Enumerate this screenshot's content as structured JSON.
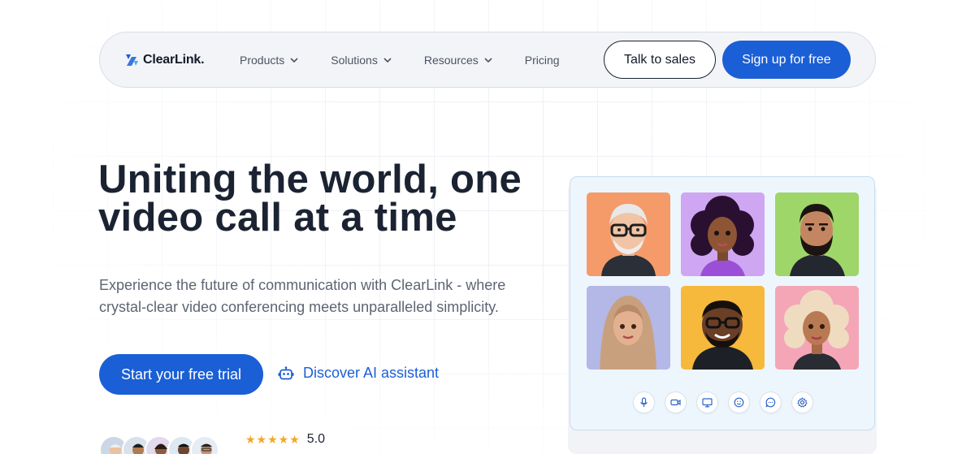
{
  "brand": {
    "name": "ClearLink.",
    "accent": "#1b5fd6"
  },
  "nav": {
    "items": [
      {
        "label": "Products",
        "has_dropdown": true
      },
      {
        "label": "Solutions",
        "has_dropdown": true
      },
      {
        "label": "Resources",
        "has_dropdown": true
      },
      {
        "label": "Pricing",
        "has_dropdown": false
      }
    ],
    "talk_to_sales": "Talk to sales",
    "sign_up": "Sign up for free"
  },
  "hero": {
    "title_line1": "Uniting the world, one",
    "title_line2": "video call at a time",
    "subtitle_line1": "Experience the future of communication with ClearLink - where",
    "subtitle_line2": "crystal-clear video conferencing meets unparalleled simplicity.",
    "cta_primary": "Start your free trial",
    "cta_secondary": "Discover AI assistant"
  },
  "social_proof": {
    "stars": "★★★★★",
    "rating": "5.0"
  },
  "video_panel": {
    "participants": [
      {
        "name": "participant-elder-man",
        "bg": "#f59b6a"
      },
      {
        "name": "participant-curly-woman",
        "bg": "#cfa6f2"
      },
      {
        "name": "participant-bearded-man",
        "bg": "#9ed66a"
      },
      {
        "name": "participant-hijab-woman",
        "bg": "#b3b8e6"
      },
      {
        "name": "participant-glasses-man",
        "bg": "#f7b93c"
      },
      {
        "name": "participant-blonde-woman",
        "bg": "#f4a6b7"
      }
    ],
    "controls": [
      "mic-icon",
      "camera-icon",
      "screen-share-icon",
      "emoji-icon",
      "chat-icon",
      "settings-icon"
    ]
  }
}
